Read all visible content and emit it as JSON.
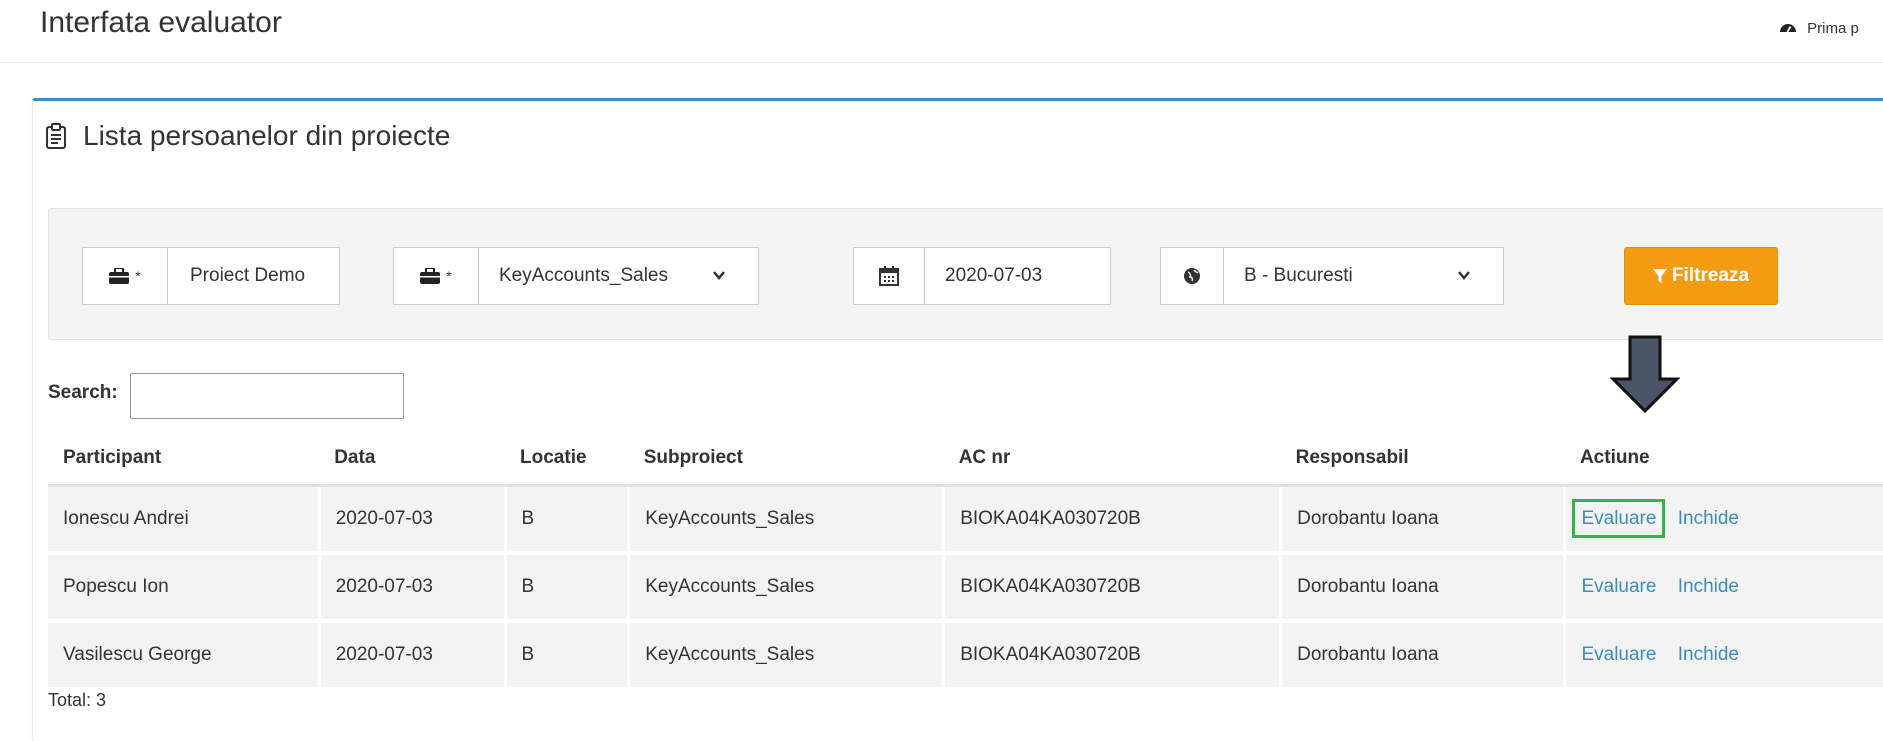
{
  "header": {
    "title": "Interfata evaluator",
    "breadcrumb_home": "Prima p"
  },
  "box": {
    "title": "Lista persoanelor din proiecte"
  },
  "filters": {
    "project": {
      "required_mark": "*",
      "value": "Proiect Demo"
    },
    "subproject": {
      "required_mark": "*",
      "value": "KeyAccounts_Sales"
    },
    "date": {
      "value": "2020-07-03"
    },
    "location": {
      "value": "B - Bucuresti"
    },
    "button_label": "Filtreaza"
  },
  "search": {
    "label": "Search:",
    "value": ""
  },
  "table": {
    "columns": [
      "Participant",
      "Data",
      "Locatie",
      "Subproiect",
      "AC nr",
      "Responsabil",
      "Actiune"
    ],
    "rows": [
      {
        "participant": "Ionescu Andrei",
        "data": "2020-07-03",
        "locatie": "B",
        "subproiect": "KeyAccounts_Sales",
        "ac_nr": "BIOKA04KA030720B",
        "responsabil": "Dorobantu Ioana",
        "evaluate": "Evaluare",
        "close": "Inchide"
      },
      {
        "participant": "Popescu Ion",
        "data": "2020-07-03",
        "locatie": "B",
        "subproiect": "KeyAccounts_Sales",
        "ac_nr": "BIOKA04KA030720B",
        "responsabil": "Dorobantu Ioana",
        "evaluate": "Evaluare",
        "close": "Inchide"
      },
      {
        "participant": "Vasilescu George",
        "data": "2020-07-03",
        "locatie": "B",
        "subproiect": "KeyAccounts_Sales",
        "ac_nr": "BIOKA04KA030720B",
        "responsabil": "Dorobantu Ioana",
        "evaluate": "Evaluare",
        "close": "Inchide"
      }
    ]
  },
  "footer": {
    "total": "Total: 3"
  },
  "colors": {
    "accent": "#3c8dbc",
    "button": "#f39c12",
    "highlight": "#2eb84a",
    "arrow": "#4a5568"
  },
  "icons": [
    "dashboard-icon",
    "clipboard-icon",
    "briefcase-icon",
    "calendar-icon",
    "globe-icon",
    "filter-icon",
    "chevron-down-icon",
    "arrow-down-icon"
  ]
}
